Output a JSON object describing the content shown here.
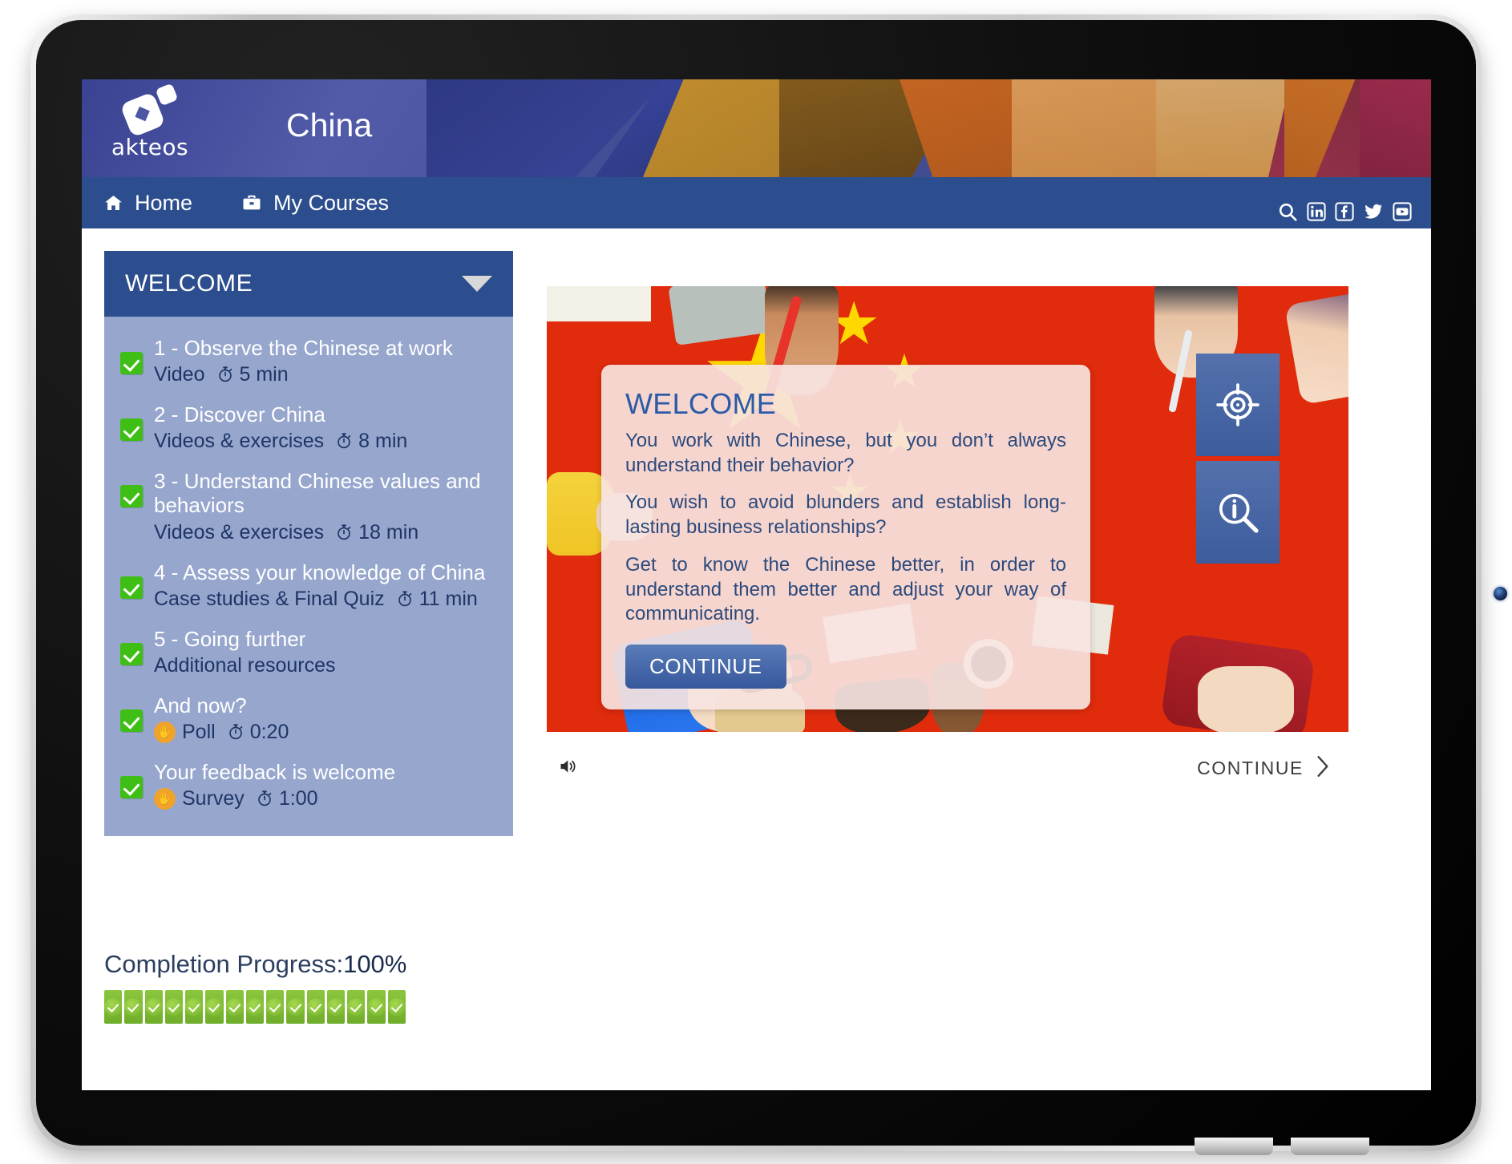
{
  "colors": {
    "brand_blue": "#2d4e8e",
    "sidebar_blue": "#97a6cd",
    "check_green": "#3fbf16",
    "flag_red": "#e02b0c",
    "star_yellow": "#ffd800",
    "dialog_bg": "#f7e4e1",
    "dialog_text": "#2c4a7c",
    "progress_green": "#8cc63f",
    "accent_orange": "#f0a32a"
  },
  "header": {
    "brand_name": "akteos",
    "logo_icon": "akteos-squares-logo",
    "course_title": "China",
    "social": [
      {
        "name": "search-icon",
        "label": "Search"
      },
      {
        "name": "linkedin-icon",
        "label": "LinkedIn"
      },
      {
        "name": "facebook-icon",
        "label": "Facebook"
      },
      {
        "name": "twitter-icon",
        "label": "Twitter"
      },
      {
        "name": "youtube-icon",
        "label": "YouTube"
      }
    ]
  },
  "nav": {
    "items": [
      {
        "label": "Home",
        "icon": "home-icon"
      },
      {
        "label": "My Courses",
        "icon": "briefcase-icon"
      }
    ]
  },
  "sidebar": {
    "section_title": "WELCOME",
    "collapse_icon": "chevron-down-icon",
    "lessons": [
      {
        "title": "1 - Observe the Chinese at work",
        "type": "Video",
        "duration": "5 min",
        "status_icon": "checkbox-checked-icon",
        "badge": null
      },
      {
        "title": "2 - Discover China",
        "type": "Videos & exercises",
        "duration": "8 min",
        "status_icon": "checkbox-checked-icon",
        "badge": null
      },
      {
        "title": "3 - Understand Chinese values and behaviors",
        "type": "Videos & exercises",
        "duration": "18 min",
        "status_icon": "checkbox-checked-icon",
        "badge": null
      },
      {
        "title": "4 - Assess your knowledge of China",
        "type": "Case studies & Final Quiz",
        "duration": "11 min",
        "status_icon": "checkbox-checked-icon",
        "badge": null
      },
      {
        "title": "5 - Going further",
        "type": "Additional resources",
        "duration": "",
        "status_icon": "checkbox-checked-icon",
        "badge": null
      },
      {
        "title": "And now?",
        "type": "Poll",
        "duration": "0:20",
        "status_icon": "checkbox-checked-icon",
        "badge": "hand-raised-icon"
      },
      {
        "title": "Your feedback is welcome",
        "type": "Survey",
        "duration": "1:00",
        "status_icon": "checkbox-checked-icon",
        "badge": "hand-raised-icon"
      }
    ]
  },
  "slide": {
    "background_description": "Chinese flag red background with yellow stars and overhead hands at a table",
    "side_buttons": [
      {
        "name": "objectives-target-icon",
        "label": "Objectives"
      },
      {
        "name": "info-magnifier-icon",
        "label": "More information"
      }
    ],
    "dialog": {
      "title": "WELCOME",
      "paragraphs": [
        "You work with Chinese, but you don’t always understand their behavior?",
        "You wish to avoid blunders and establish long-lasting business relationships?",
        "Get to know the Chinese better, in order to understand them better and adjust your way of communicating."
      ],
      "button_label": "CONTINUE"
    }
  },
  "player": {
    "volume_icon": "speaker-icon",
    "continue_label": "CONTINUE",
    "next_icon": "chevron-right-icon"
  },
  "progress": {
    "label": "Completion Progress:",
    "percent": "100%",
    "segments_total": 15,
    "segments_filled": 15
  }
}
